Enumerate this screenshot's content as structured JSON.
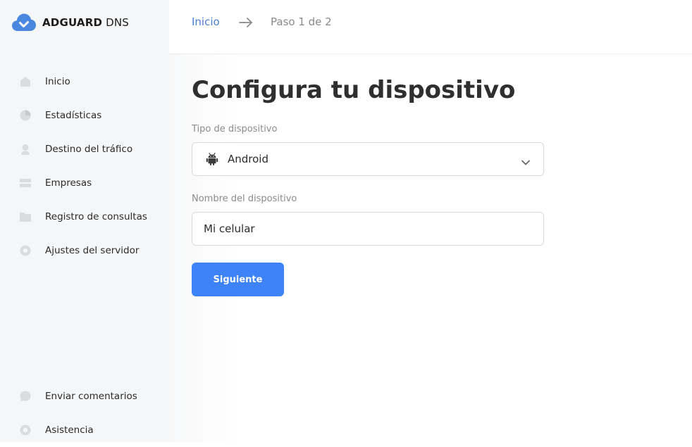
{
  "app": {
    "brand_bold": "ADGUARD",
    "brand_light": "DNS",
    "logo_icon": "cloud-check-icon",
    "accent_color": "#3d82f6",
    "link_color": "#4a7fd6"
  },
  "sidebar": {
    "items": [
      {
        "label": "Inicio",
        "icon": "home-icon"
      },
      {
        "label": "Estadísticas",
        "icon": "pie-chart-icon"
      },
      {
        "label": "Destino del tráfico",
        "icon": "location-pin-icon"
      },
      {
        "label": "Empresas",
        "icon": "card-icon"
      },
      {
        "label": "Registro de consultas",
        "icon": "folder-icon"
      },
      {
        "label": "Ajustes del servidor",
        "icon": "gear-icon"
      }
    ],
    "bottom_items": [
      {
        "label": "Enviar comentarios",
        "icon": "chat-bubble-icon"
      },
      {
        "label": "Asistencia",
        "icon": "lifebuoy-icon"
      }
    ]
  },
  "breadcrumb": {
    "home": "Inicio",
    "arrow_icon": "arrow-right-icon",
    "step": "Paso 1 de 2"
  },
  "main": {
    "title": "Configura tu dispositivo",
    "device_type": {
      "label": "Tipo de dispositivo",
      "value": "Android",
      "icon": "android-icon"
    },
    "device_name": {
      "label": "Nombre del dispositivo",
      "value": "Mi celular"
    },
    "next_button": "Siguiente"
  }
}
